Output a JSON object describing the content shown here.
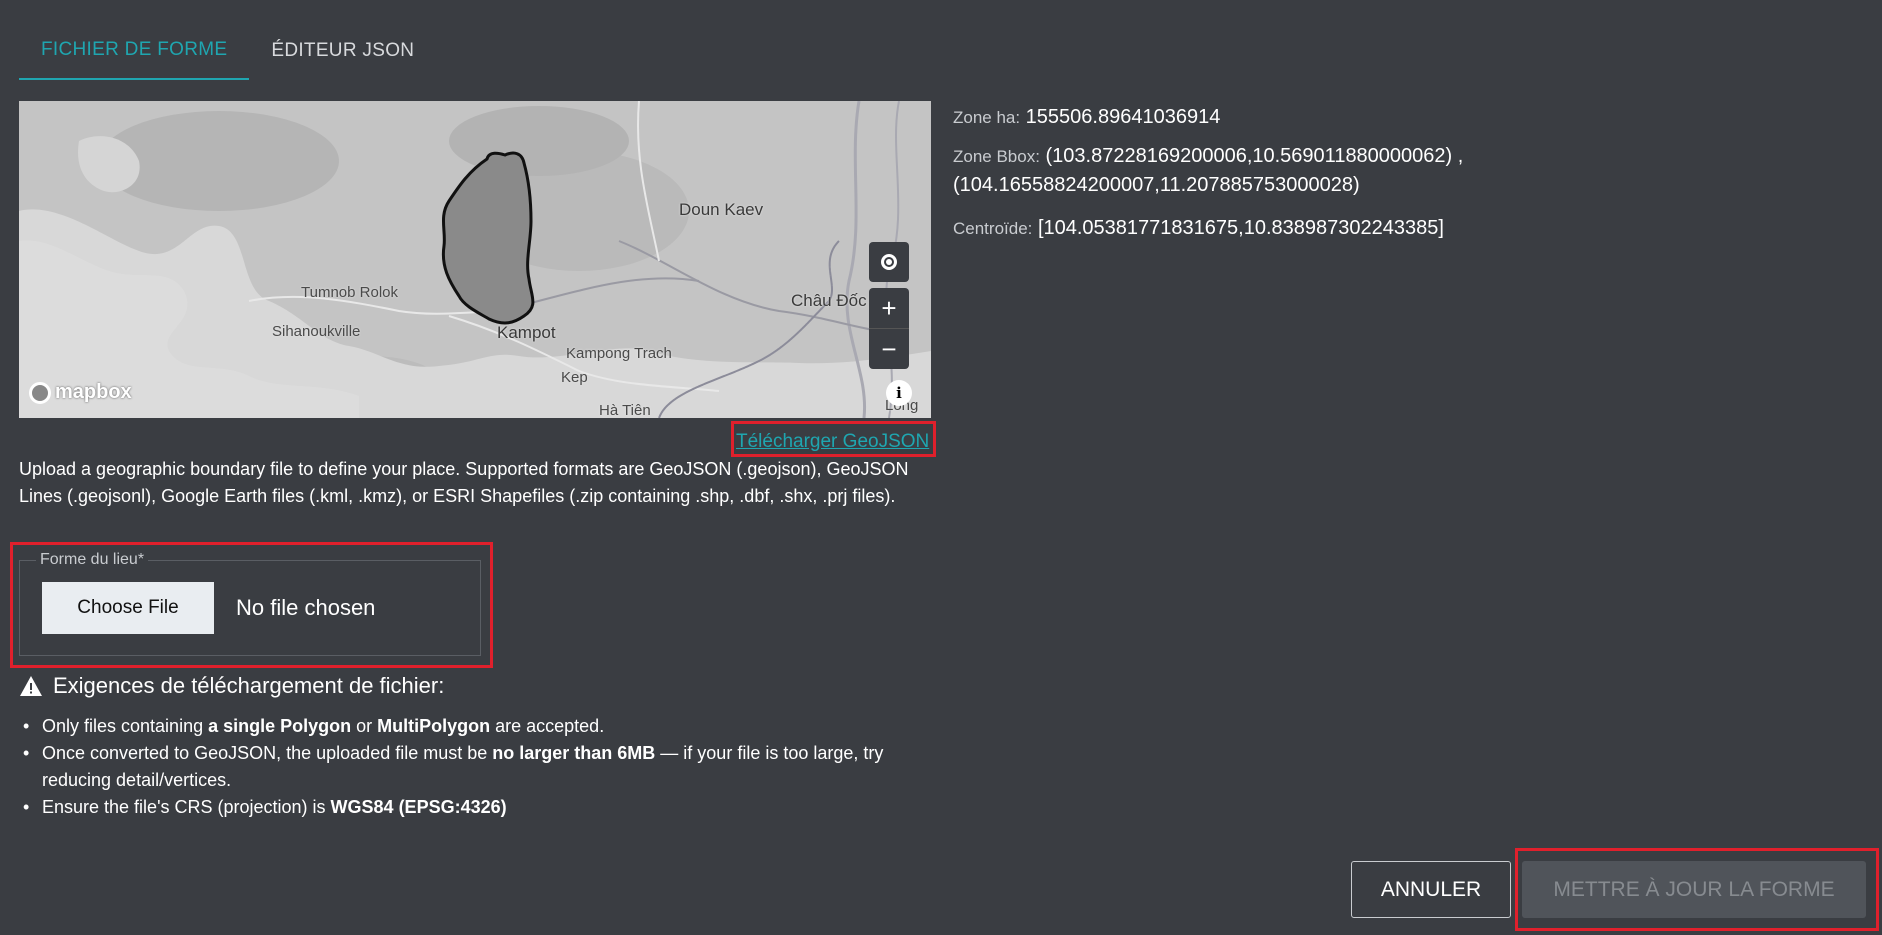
{
  "tabs": [
    {
      "label": "FICHIER DE FORME",
      "active": true
    },
    {
      "label": "ÉDITEUR JSON",
      "active": false
    }
  ],
  "map": {
    "labels": {
      "doun_kaev": "Doun Kaev",
      "tumnob_rolok": "Tumnob Rolok",
      "sihanoukville": "Sihanoukville",
      "kampot": "Kampot",
      "chau_doc": "Châu Đốc",
      "kampong_trach": "Kampong Trach",
      "kep": "Kep",
      "ha_tien": "Hà Tiên",
      "long": "Long"
    },
    "logo_text": "mapbox",
    "controls": {
      "zoom_in": "+",
      "zoom_out": "−",
      "info": "i"
    }
  },
  "download_link": "Télécharger GeoJSON",
  "description": "Upload a geographic boundary file to define your place. Supported formats are GeoJSON (.geojson), GeoJSON Lines (.geojsonl), Google Earth files (.kml, .kmz), or ESRI Shapefiles (.zip containing .shp, .dbf, .shx, .prj files).",
  "file_field": {
    "label": "Forme du lieu*",
    "button_label": "Choose File",
    "status": "No file chosen"
  },
  "requirements": {
    "title": "Exigences de téléchargement de fichier:",
    "items": [
      {
        "pre": "Only files containing ",
        "b1": "a single Polygon",
        "mid": " or ",
        "b2": "MultiPolygon",
        "post": " are accepted."
      },
      {
        "pre": "Once converted to GeoJSON, the uploaded file must be ",
        "b1": "no larger than 6MB",
        "post": " — if your file is too large, try reducing detail/vertices."
      },
      {
        "pre": "Ensure the file's CRS (projection) is ",
        "b1": "WGS84 (EPSG:4326)"
      }
    ]
  },
  "info": {
    "area_label": "Zone ha:",
    "area_value": "155506.89641036914",
    "bbox_label": "Zone Bbox:",
    "bbox_line1": "(103.87228169200006,10.569011880000062) ,",
    "bbox_line2": "(104.16558824200007,11.207885753000028)",
    "centroid_label": "Centroïde:",
    "centroid_value": "[104.05381771831675,10.838987302243385]"
  },
  "buttons": {
    "cancel": "ANNULER",
    "update": "METTRE À JOUR LA FORME"
  },
  "colors": {
    "accent": "#1fa6b0",
    "highlight": "#e0202c",
    "background": "#3a3d42"
  }
}
